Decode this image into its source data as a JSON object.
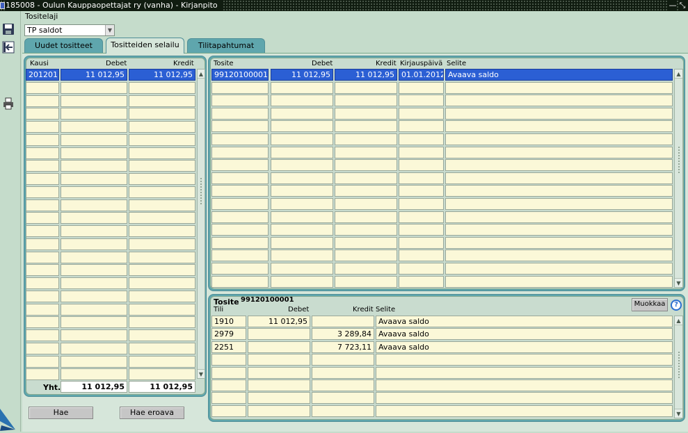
{
  "window": {
    "title": "185008 - Oulun Kauppaopettajat ry (vanha) - Kirjanpito"
  },
  "toolbar": {
    "icons": [
      "save-icon",
      "exit-icon",
      "print-icon"
    ]
  },
  "form": {
    "tositelaji_label": "Tositelaji",
    "tositelaji_value": "TP saldot"
  },
  "tabs": [
    {
      "label": "Uudet tositteet"
    },
    {
      "label": "Tositteiden selailu"
    },
    {
      "label": "Tilitapahtumat"
    }
  ],
  "periods": {
    "headers": {
      "kausi": "Kausi",
      "debet": "Debet",
      "kredit": "Kredit"
    },
    "rows": [
      {
        "kausi": "201201",
        "debet": "11 012,95",
        "kredit": "11 012,95"
      }
    ],
    "total_label": "Yht.",
    "total_debet": "11 012,95",
    "total_kredit": "11 012,95"
  },
  "vouchers": {
    "headers": {
      "tosite": "Tosite",
      "debet": "Debet",
      "kredit": "Kredit",
      "kirjauspaiva": "Kirjauspäivä",
      "selite": "Selite"
    },
    "rows": [
      {
        "tosite": "99120100001",
        "debet": "11 012,95",
        "kredit": "11 012,95",
        "kirjauspaiva": "01.01.2012",
        "selite": "Avaava saldo"
      }
    ]
  },
  "detail": {
    "title_label": "Tosite",
    "title_value": "99120100001",
    "edit_button": "Muokkaa",
    "help_icon": "?",
    "headers": {
      "tili": "Tili",
      "debet": "Debet",
      "kredit": "Kredit",
      "selite": "Selite"
    },
    "rows": [
      {
        "tili": "1910",
        "debet": "11 012,95",
        "kredit": "",
        "selite": "Avaava saldo"
      },
      {
        "tili": "2979",
        "debet": "",
        "kredit": "3 289,84",
        "selite": "Avaava saldo"
      },
      {
        "tili": "2251",
        "debet": "",
        "kredit": "7 723,11",
        "selite": "Avaava saldo"
      }
    ]
  },
  "buttons": {
    "hae": "Hae",
    "hae_eroava": "Hae eroava"
  }
}
